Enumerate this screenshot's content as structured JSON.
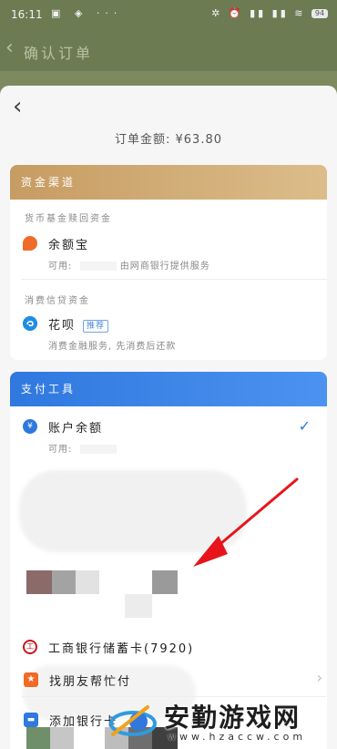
{
  "status_bar": {
    "time": "16:11",
    "left_icons": "▣ ◈ ···",
    "right_icons": "✲ ⏰ ▮▮ ▮▮ ≋",
    "battery": "94"
  },
  "under_header": {
    "back_glyph": "‹",
    "title": "确认订单"
  },
  "sheet": {
    "back_glyph": "‹",
    "order_amount_label": "订单金额: ¥63.80"
  },
  "fund_channel": {
    "header": "资金渠道",
    "section1_label": "货币基金赎回资金",
    "yuebao": {
      "title": "余额宝",
      "available_label": "可用:",
      "service_text": "由网商银行提供服务"
    },
    "section2_label": "消费信贷资金",
    "huabei": {
      "title": "花呗",
      "tag": "推荐",
      "subtitle": "消费金融服务, 先消费后还款"
    }
  },
  "pay_tools": {
    "header": "支付工具",
    "balance": {
      "title": "账户余额",
      "available_label": "可用:",
      "selected_glyph": "✓"
    },
    "icbc": {
      "title": "工商银行储蓄卡(7920)"
    },
    "friend_pay": {
      "title": "找朋友帮忙付",
      "chevron": "›"
    },
    "add_card": {
      "title": "添加银行卡"
    }
  },
  "watermark": {
    "title": "安勤游戏网",
    "url": "www.hzaccw.com"
  },
  "colors": {
    "gold": "#c69c63",
    "blue": "#2f78de",
    "yuebao_orange": "#f06a28",
    "huabei_blue": "#1f8fe0",
    "icbc_red": "#c8161d",
    "arrow_red": "#e8141b"
  }
}
